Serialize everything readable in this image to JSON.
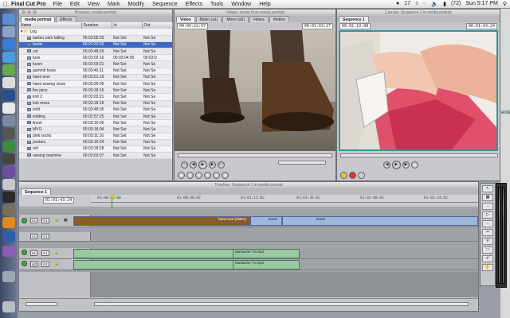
{
  "menubar": {
    "app_name": "Final Cut Pro",
    "items": [
      "File",
      "Edit",
      "View",
      "Mark",
      "Modify",
      "Sequence",
      "Effects",
      "Tools",
      "Window",
      "Help"
    ],
    "status_bubble": "17",
    "battery": "(72)",
    "clock": "Sun 5:17 PM"
  },
  "browser": {
    "title": "Browser: media portrait",
    "tabs": [
      "media portrait",
      "Effects"
    ],
    "columns": [
      "Name",
      "Duration",
      "In",
      "Out"
    ],
    "bin_name": "Log",
    "rows": [
      {
        "name": "barber sam falling",
        "duration": "00:03:05:03",
        "in": "Not Set",
        "out": "Not Se"
      },
      {
        "name": "boots",
        "duration": "00:01:22:02",
        "in": "Not Set",
        "out": "Not Se",
        "selected": true
      },
      {
        "name": "cut",
        "duration": "00:03:48:26",
        "in": "Not Set",
        "out": "Not Se"
      },
      {
        "name": "fuse",
        "duration": "00:03:02:16",
        "in": "00:02:04:05",
        "out": "00:03:0"
      },
      {
        "name": "fuson",
        "duration": "00:03:03:21",
        "in": "Not Set",
        "out": "Not Se"
      },
      {
        "name": "gummit tears",
        "duration": "00:03:46:11",
        "in": "Not Set",
        "out": "Not Se"
      },
      {
        "name": "hand sew",
        "duration": "00:03:51:16",
        "in": "Not Set",
        "out": "Not Se"
      },
      {
        "name": "hand sewing close",
        "duration": "00:03:29:06",
        "in": "Not Set",
        "out": "Not Se"
      },
      {
        "name": "fire juice",
        "duration": "00:03:18:16",
        "in": "Not Set",
        "out": "Not Se"
      },
      {
        "name": "knit 2",
        "duration": "00:03:03:21",
        "in": "Not Set",
        "out": "Not Se"
      },
      {
        "name": "knit moss",
        "duration": "00:03:18:16",
        "in": "Not Set",
        "out": "Not Se"
      },
      {
        "name": "knitt",
        "duration": "00:03:48:05",
        "in": "Not Set",
        "out": "Not Se"
      },
      {
        "name": "knitting",
        "duration": "00:02:57:25",
        "in": "Not Set",
        "out": "Not Se"
      },
      {
        "name": "linset",
        "duration": "00:03:16:06",
        "in": "Not Set",
        "out": "Not Se"
      },
      {
        "name": "MVI1",
        "duration": "00:03:18:04",
        "in": "Not Set",
        "out": "Not Se"
      },
      {
        "name": "pink socks",
        "duration": "00:03:11:16",
        "in": "Not Set",
        "out": "Not Se"
      },
      {
        "name": "posters",
        "duration": "00:03:16:24",
        "in": "Not Set",
        "out": "Not Se"
      },
      {
        "name": "roll",
        "duration": "00:03:18:28",
        "in": "Not Set",
        "out": "Not Se"
      },
      {
        "name": "sewing machine",
        "duration": "00:03:03:07",
        "in": "Not Set",
        "out": "Not Se"
      }
    ]
  },
  "viewer": {
    "title": "Viewer: boots from media portrait",
    "tabs": [
      "Video",
      "Mono (a1)",
      "Mono (a2)",
      "Filters",
      "Motion"
    ],
    "timecode_left": "00:00:22:07",
    "timecode_right": "00:01:03:27"
  },
  "canvas": {
    "title": "Canvas: Sequence 1 in media portrait",
    "tabs": [
      "Sequence 1"
    ],
    "timecode_left": "00:02:19:08",
    "timecode_right": "00:01:43:24"
  },
  "timeline": {
    "title": "Timeline: Sequence 1 in media portrait",
    "tab": "Sequence 1",
    "timecode": "01:01:43:24",
    "ruler_labels": [
      "01:00:00:00",
      "01:00:48:02",
      "01:01:12:02",
      "01:01:36:02",
      "01:02:00:02",
      "01:02:24:02"
    ],
    "track_patches": {
      "v1_src": "v1",
      "v1_dst": "V1",
      "a1_src": "a1",
      "a1_dst": "A1",
      "a2_src": "a2",
      "a2_dst": "A2"
    },
    "video_clips": [
      "hand sew (250%)",
      "boots",
      "boots"
    ],
    "audio_clips": [
      "Mustache TV.mp3",
      "Mustache TV.mp3"
    ]
  },
  "desktop": {
    "label": "ents"
  },
  "colors": {
    "selection": "#3e68c2",
    "audio_clip": "#9ac8a4",
    "video_clip": "#9db6dc"
  }
}
